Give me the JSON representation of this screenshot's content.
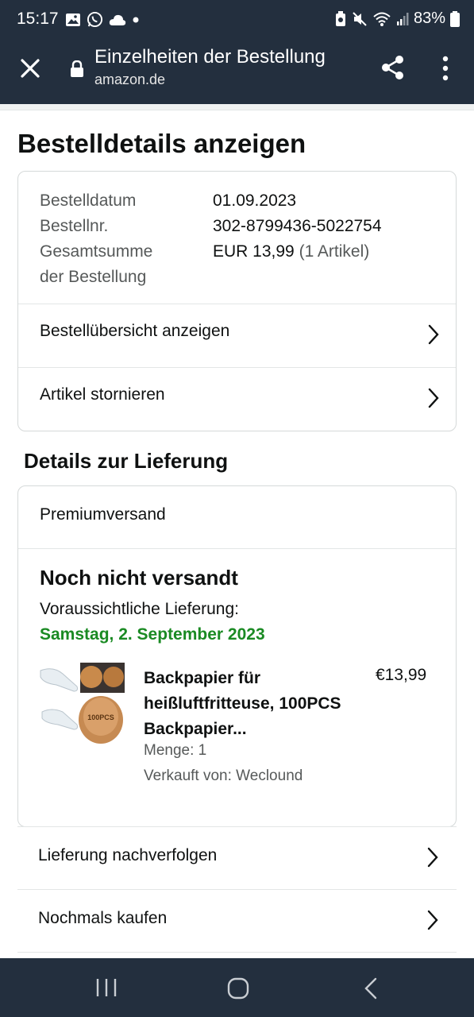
{
  "status_bar": {
    "time": "15:17",
    "battery": "83%"
  },
  "browser": {
    "title": "Einzelheiten der Bestellung",
    "url": "amazon.de"
  },
  "page_title": "Bestelldetails anzeigen",
  "summary": {
    "date_label": "Bestelldatum",
    "date_value": "01.09.2023",
    "order_no_label": "Bestellnr.",
    "order_no_value": "302-8799436-5022754",
    "total_label_line1": "Gesamtsumme",
    "total_label_line2": "der Bestellung",
    "total_value": "EUR 13,99",
    "total_items": "(1 Artikel)"
  },
  "order_links": {
    "overview": "Bestellübersicht anzeigen",
    "cancel": "Artikel stornieren"
  },
  "delivery": {
    "section_title": "Details zur Lieferung",
    "shipping_method": "Premiumversand",
    "status": "Noch nicht versandt",
    "eta_label": "Voraussichtliche Lieferung:",
    "eta_date": "Samstag, 2. September 2023",
    "eta_color": "#1a8a23",
    "product": {
      "name": "Backpapier für heißluftfritteuse, 100PCS Backpapier...",
      "price": "€13,99",
      "quantity": "Menge: 1",
      "seller": "Verkauft von: Weclound",
      "image_text": "100PCS"
    }
  },
  "actions": {
    "track": "Lieferung nachverfolgen",
    "buy_again": "Nochmals kaufen"
  },
  "colors": {
    "header_bg": "#232f3e",
    "border": "#d5d9d9"
  }
}
